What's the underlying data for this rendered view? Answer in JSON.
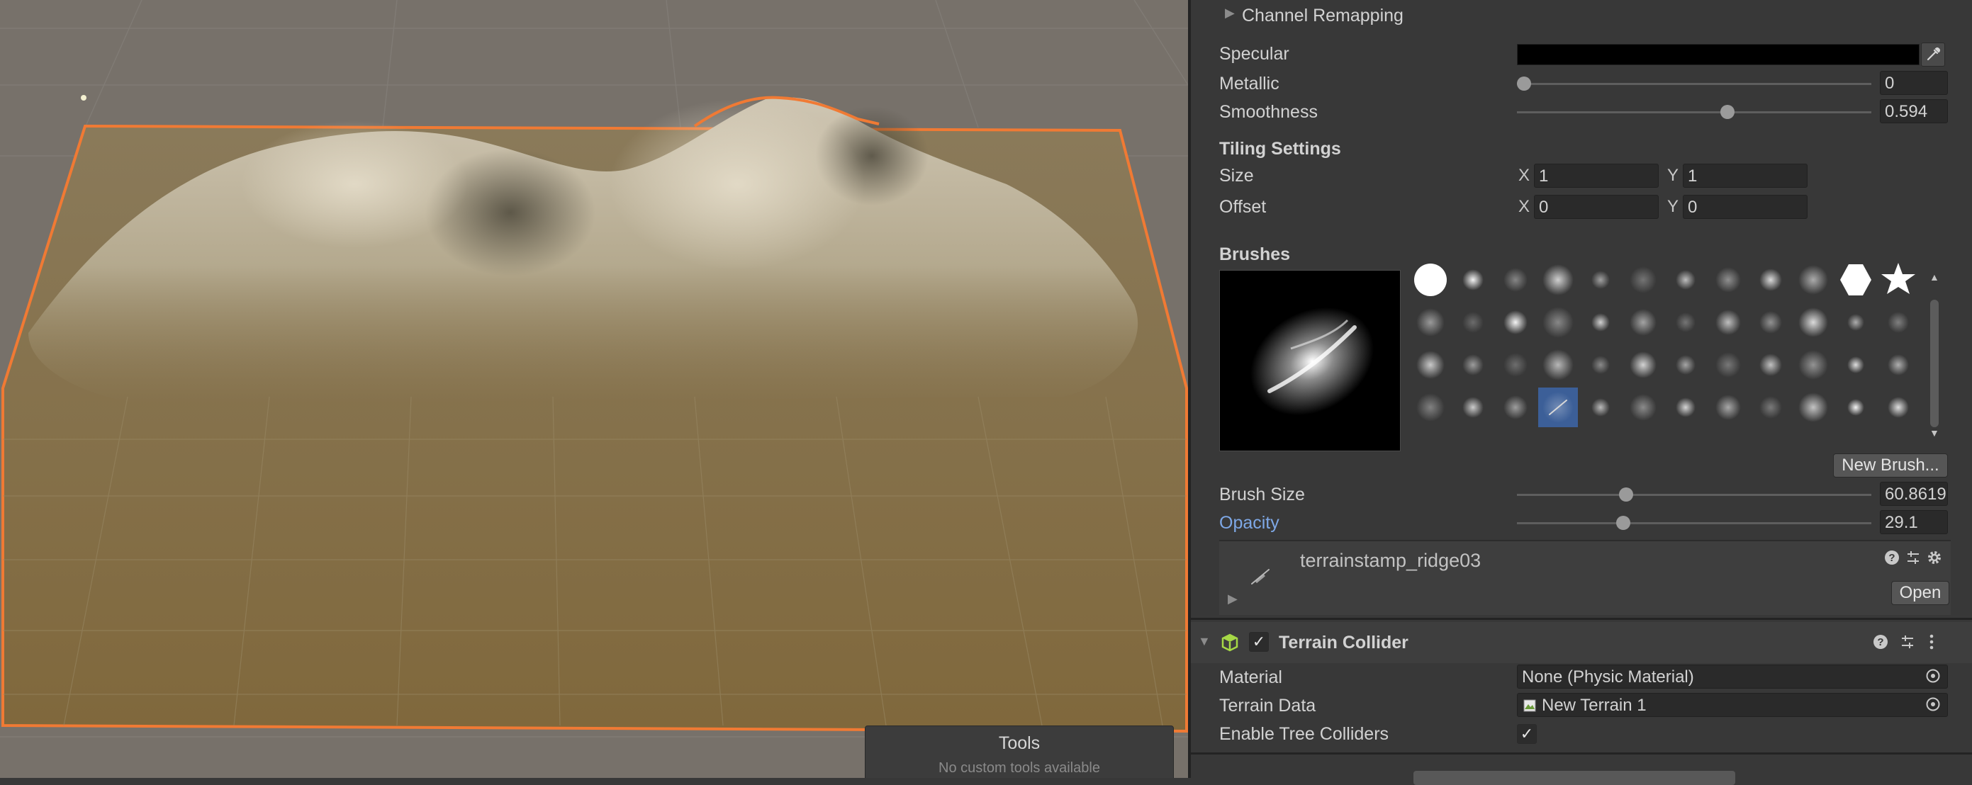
{
  "tools_overlay": {
    "title": "Tools",
    "subtitle": "No custom tools available"
  },
  "material": {
    "channel_remapping": "Channel Remapping",
    "specular": {
      "label": "Specular",
      "color": "#000000"
    },
    "metallic": {
      "label": "Metallic",
      "value": "0",
      "fraction": 0.0
    },
    "smoothness": {
      "label": "Smoothness",
      "value": "0.594",
      "fraction": 0.594
    }
  },
  "tiling": {
    "title": "Tiling Settings",
    "size": {
      "label": "Size",
      "x_label": "X",
      "x": "1",
      "y_label": "Y",
      "y": "1"
    },
    "offset": {
      "label": "Offset",
      "x_label": "X",
      "x": "0",
      "y_label": "Y",
      "y": "0"
    }
  },
  "brushes": {
    "title": "Brushes",
    "new_brush_label": "New Brush...",
    "brush_size": {
      "label": "Brush Size",
      "value": "60.8619",
      "fraction": 0.3
    },
    "opacity": {
      "label": "Opacity",
      "value": "29.1",
      "fraction": 0.291
    },
    "selected_brush": {
      "name": "terrainstamp_ridge03",
      "open_label": "Open"
    },
    "selected_index": 39,
    "total_count": 48
  },
  "terrain_collider": {
    "title": "Terrain Collider",
    "enabled": true,
    "material": {
      "label": "Material",
      "value": "None (Physic Material)"
    },
    "terrain_data": {
      "label": "Terrain Data",
      "value": "New Terrain 1"
    },
    "enable_tree_colliders": {
      "label": "Enable Tree Colliders",
      "checked": true
    }
  },
  "colors": {
    "accent_label": "#7ea8e6",
    "selection_outline": "#f07a34",
    "selected_brush_bg": "#3c5f98",
    "component_icon": "#a6d846"
  },
  "icons": {
    "foldout": "triangle-right-icon",
    "eyedropper": "eyedropper-icon",
    "help": "help-icon",
    "preset": "preset-sliders-icon",
    "settings": "gear-icon",
    "more": "kebab-menu-icon",
    "object_picker": "target-circle-icon",
    "terrain_data": "terrain-data-icon"
  }
}
